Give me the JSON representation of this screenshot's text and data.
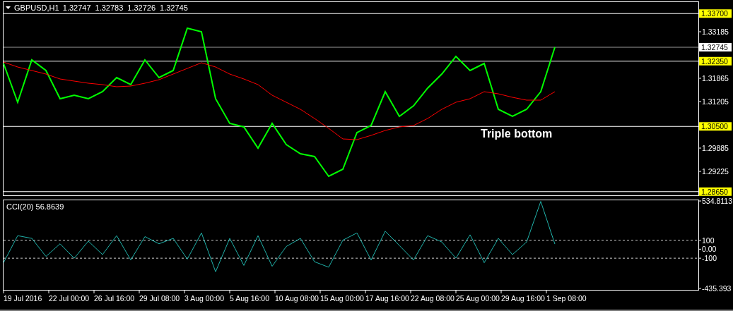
{
  "chart_header": {
    "symbol": "GBPUSD,H1",
    "quotes": [
      "1.32747",
      "1.32783",
      "1.32726",
      "1.32745"
    ]
  },
  "price_chart": {
    "chart_data": {
      "type": "line",
      "series": [
        {
          "color": "#00ff00",
          "values": [
            1.32285,
            1.31185,
            1.32385,
            1.32085,
            1.31285,
            1.31385,
            1.31285,
            1.31485,
            1.31885,
            1.31685,
            1.32385,
            1.31885,
            1.32085,
            1.33285,
            1.33185,
            1.31285,
            1.30585,
            1.30485,
            1.29885,
            1.30585,
            1.29985,
            1.29725,
            1.29645,
            1.29085,
            1.29285,
            1.30325,
            1.30525,
            1.31485,
            1.30785,
            1.31085,
            1.31585,
            1.31985,
            1.32485,
            1.32085,
            1.32285,
            1.30985,
            1.30785,
            1.30985,
            1.31485,
            1.32745
          ]
        },
        {
          "color": "#ff0000",
          "values": [
            1.32325,
            1.32185,
            1.32085,
            1.31985,
            1.31845,
            1.31785,
            1.31725,
            1.31685,
            1.31625,
            1.31645,
            1.31725,
            1.31825,
            1.31985,
            1.32145,
            1.32305,
            1.32185,
            1.31985,
            1.31845,
            1.31685,
            1.31385,
            1.31185,
            1.30985,
            1.30725,
            1.30445,
            1.30145,
            1.30125,
            1.30245,
            1.30385,
            1.30485,
            1.30525,
            1.30725,
            1.30985,
            1.31185,
            1.31285,
            1.31485,
            1.31425,
            1.31325,
            1.31245,
            1.31245,
            1.31485
          ]
        }
      ],
      "ylim": [
        1.28545,
        1.34045
      ],
      "yticks": [
        {
          "value": 1.33185,
          "label": "1.33185"
        },
        {
          "value": 1.31865,
          "label": "1.31865"
        },
        {
          "value": 1.31205,
          "label": "1.31205"
        },
        {
          "value": 1.29885,
          "label": "1.29885"
        },
        {
          "value": 1.29225,
          "label": "1.29225"
        }
      ],
      "ref_lines": [
        {
          "axis": "y",
          "value": 1.337,
          "label": "1.33700",
          "color": "#ffffff"
        },
        {
          "axis": "y",
          "value": 1.32745,
          "label": "1.32745",
          "color": "#9a9a9a"
        },
        {
          "axis": "y",
          "value": 1.3235,
          "label": "1.32350",
          "color": "#ffffff"
        },
        {
          "axis": "y",
          "value": 1.305,
          "label": "1.30500",
          "color": "#ffffff"
        },
        {
          "axis": "y",
          "value": 1.2865,
          "label": "1.28650",
          "color": "#ffffff"
        }
      ],
      "annotations": [
        "Triple bottom"
      ]
    }
  },
  "indicator_chart": {
    "chart_data": {
      "type": "line",
      "title": "CCI(20) 56.8639",
      "series": [
        {
          "color": "#20b2aa",
          "values": [
            -150,
            150,
            120,
            -80,
            60,
            -100,
            90,
            -60,
            150,
            -120,
            140,
            60,
            120,
            -110,
            180,
            -250,
            120,
            -180,
            150,
            -190,
            30,
            120,
            -140,
            -200,
            100,
            180,
            -120,
            200,
            40,
            -120,
            150,
            80,
            -100,
            160,
            -150,
            120,
            -60,
            80,
            530,
            57
          ]
        }
      ],
      "ylim": [
        -435.3938,
        534.8113
      ],
      "yticks": [
        {
          "value": 534.8113,
          "label": "534.8113"
        },
        {
          "value": 100,
          "label": "100"
        },
        {
          "value": 0,
          "label": "0.00"
        },
        {
          "value": -100,
          "label": "-100"
        },
        {
          "value": -435.393,
          "label": "-435.393"
        }
      ]
    }
  },
  "time_axis": {
    "labels": [
      "19 Jul 2016",
      "22 Jul 00:00",
      "26 Jul 16:00",
      "29 Jul 08:00",
      "3 Aug 00:00",
      "5 Aug 16:00",
      "10 Aug 08:00",
      "15 Aug 00:00",
      "17 Aug 16:00",
      "22 Aug 08:00",
      "25 Aug 00:00",
      "29 Aug 16:00",
      "1 Sep 08:00"
    ]
  }
}
